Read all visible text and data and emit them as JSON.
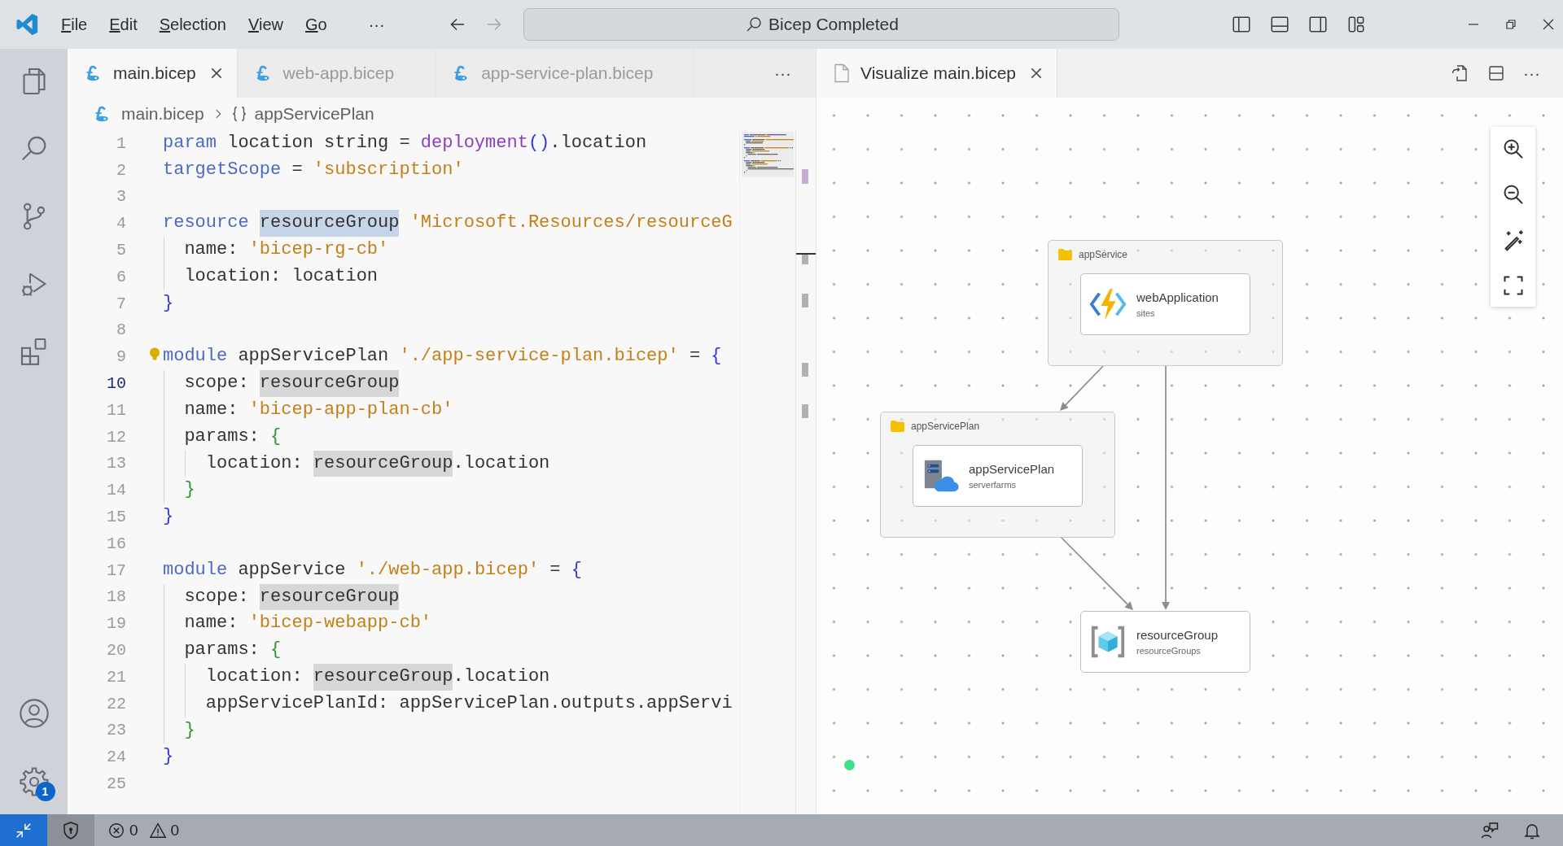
{
  "title_bar": {
    "menu": [
      "File",
      "Edit",
      "Selection",
      "View",
      "Go"
    ],
    "more": "···",
    "navigation": [
      {
        "kind": "back",
        "disabled": false
      },
      {
        "kind": "forward",
        "disabled": true
      }
    ],
    "command_center": "Bicep Completed"
  },
  "activity_bar": {
    "settings_badge": "1"
  },
  "editor": {
    "tabs": [
      {
        "label": "main.bicep",
        "selected": true
      },
      {
        "label": "web-app.bicep",
        "selected": false
      },
      {
        "label": "app-service-plan.bicep",
        "selected": false
      }
    ],
    "more": "···",
    "breadcrumbs": [
      {
        "kind": "file",
        "label": "main.bicep"
      },
      {
        "kind": "module",
        "label": "appServicePlan"
      }
    ],
    "lines": [
      {
        "number": "1",
        "active": false,
        "lightbulb": false,
        "tokens": [
          {
            "kind": "keyword",
            "text": "param"
          },
          {
            "kind": "plain",
            "text": " location string = "
          },
          {
            "kind": "function",
            "text": "deployment"
          },
          {
            "kind": "brace",
            "text": "()"
          },
          {
            "kind": "plain",
            "text": ".location"
          }
        ]
      },
      {
        "number": "2",
        "active": false,
        "lightbulb": false,
        "tokens": [
          {
            "kind": "keyword",
            "text": "targetScope"
          },
          {
            "kind": "plain",
            "text": " = "
          },
          {
            "kind": "string",
            "text": "'subscription'"
          }
        ]
      },
      {
        "number": "3",
        "active": false,
        "lightbulb": false
      },
      {
        "number": "4",
        "active": false,
        "lightbulb": false,
        "tokens": [
          {
            "kind": "keyword",
            "text": "resource "
          },
          {
            "kind": "write-highlight",
            "text": "resourceGroup"
          },
          {
            "kind": "string",
            "text": " 'Microsoft.Resources/resourceG"
          }
        ]
      },
      {
        "number": "5",
        "active": false,
        "lightbulb": false,
        "tokens": [
          {
            "kind": "plain",
            "text": "  name: "
          },
          {
            "kind": "string",
            "text": "'bicep-rg-cb'"
          }
        ]
      },
      {
        "number": "6",
        "active": false,
        "lightbulb": false,
        "tokens": [
          {
            "kind": "plain",
            "text": "  location: location"
          }
        ]
      },
      {
        "number": "7",
        "active": false,
        "lightbulb": false,
        "tokens": [
          {
            "kind": "brace",
            "text": "}"
          }
        ]
      },
      {
        "number": "8",
        "active": false,
        "lightbulb": false
      },
      {
        "number": "9",
        "active": false,
        "lightbulb": true,
        "tokens": [
          {
            "kind": "keyword",
            "text": "module"
          },
          {
            "kind": "plain",
            "text": " appServicePlan "
          },
          {
            "kind": "string",
            "text": "'./app-service-plan.bicep'"
          },
          {
            "kind": "plain",
            "text": " = "
          },
          {
            "kind": "brace",
            "text": "{"
          }
        ]
      },
      {
        "number": "10",
        "active": true,
        "lightbulb": false,
        "tokens": [
          {
            "kind": "plain",
            "text": "  scope: "
          },
          {
            "kind": "read-highlight",
            "text": "resourceGroup"
          }
        ]
      },
      {
        "number": "11",
        "active": false,
        "lightbulb": false,
        "tokens": [
          {
            "kind": "plain",
            "text": "  name: "
          },
          {
            "kind": "string",
            "text": "'bicep-app-plan-cb'"
          }
        ]
      },
      {
        "number": "12",
        "active": false,
        "lightbulb": false,
        "tokens": [
          {
            "kind": "plain",
            "text": "  params: "
          },
          {
            "kind": "nested-brace",
            "text": "{"
          }
        ]
      },
      {
        "number": "13",
        "active": false,
        "lightbulb": false,
        "tokens": [
          {
            "kind": "plain",
            "text": "    location: "
          },
          {
            "kind": "read-highlight",
            "text": "resourceGroup"
          },
          {
            "kind": "plain",
            "text": ".location"
          }
        ]
      },
      {
        "number": "14",
        "active": false,
        "lightbulb": false,
        "tokens": [
          {
            "kind": "nested-brace",
            "text": "  }"
          }
        ]
      },
      {
        "number": "15",
        "active": false,
        "lightbulb": false,
        "tokens": [
          {
            "kind": "brace",
            "text": "}"
          }
        ]
      },
      {
        "number": "16",
        "active": false,
        "lightbulb": false
      },
      {
        "number": "17",
        "active": false,
        "lightbulb": false,
        "tokens": [
          {
            "kind": "keyword",
            "text": "module"
          },
          {
            "kind": "plain",
            "text": " appService "
          },
          {
            "kind": "string",
            "text": "'./web-app.bicep'"
          },
          {
            "kind": "plain",
            "text": " = "
          },
          {
            "kind": "brace",
            "text": "{"
          }
        ]
      },
      {
        "number": "18",
        "active": false,
        "lightbulb": false,
        "tokens": [
          {
            "kind": "plain",
            "text": "  scope: "
          },
          {
            "kind": "read-highlight",
            "text": "resourceGroup"
          }
        ]
      },
      {
        "number": "19",
        "active": false,
        "lightbulb": false,
        "tokens": [
          {
            "kind": "plain",
            "text": "  name: "
          },
          {
            "kind": "string",
            "text": "'bicep-webapp-cb'"
          }
        ]
      },
      {
        "number": "20",
        "active": false,
        "lightbulb": false,
        "tokens": [
          {
            "kind": "plain",
            "text": "  params: "
          },
          {
            "kind": "nested-brace",
            "text": "{"
          }
        ]
      },
      {
        "number": "21",
        "active": false,
        "lightbulb": false,
        "tokens": [
          {
            "kind": "plain",
            "text": "    location: "
          },
          {
            "kind": "read-highlight",
            "text": "resourceGroup"
          },
          {
            "kind": "plain",
            "text": ".location"
          }
        ]
      },
      {
        "number": "22",
        "active": false,
        "lightbulb": false,
        "tokens": [
          {
            "kind": "plain",
            "text": "    appServicePlanId: appServicePlan.outputs.appServi"
          }
        ]
      },
      {
        "number": "23",
        "active": false,
        "lightbulb": false,
        "tokens": [
          {
            "kind": "nested-brace",
            "text": "  }"
          }
        ]
      },
      {
        "number": "24",
        "active": false,
        "lightbulb": false,
        "tokens": [
          {
            "kind": "brace",
            "text": "}"
          }
        ]
      },
      {
        "number": "25",
        "active": false,
        "lightbulb": false
      }
    ]
  },
  "visualizer": {
    "tabs": [
      {
        "label": "Visualize main.bicep",
        "selected": true
      }
    ],
    "more": "···",
    "modules": [
      {
        "name": "appService",
        "resources": [
          {
            "name": "webApplication",
            "type": "sites",
            "kind": "web-app"
          }
        ]
      },
      {
        "name": "appServicePlan",
        "resources": [
          {
            "name": "appServicePlan",
            "type": "serverfarms",
            "kind": "server-farm"
          }
        ]
      }
    ],
    "resources": [
      {
        "name": "resourceGroup",
        "type": "resourceGroups",
        "kind": "resource-group"
      }
    ]
  },
  "status_bar": {
    "errors": "0",
    "warnings": "0"
  }
}
